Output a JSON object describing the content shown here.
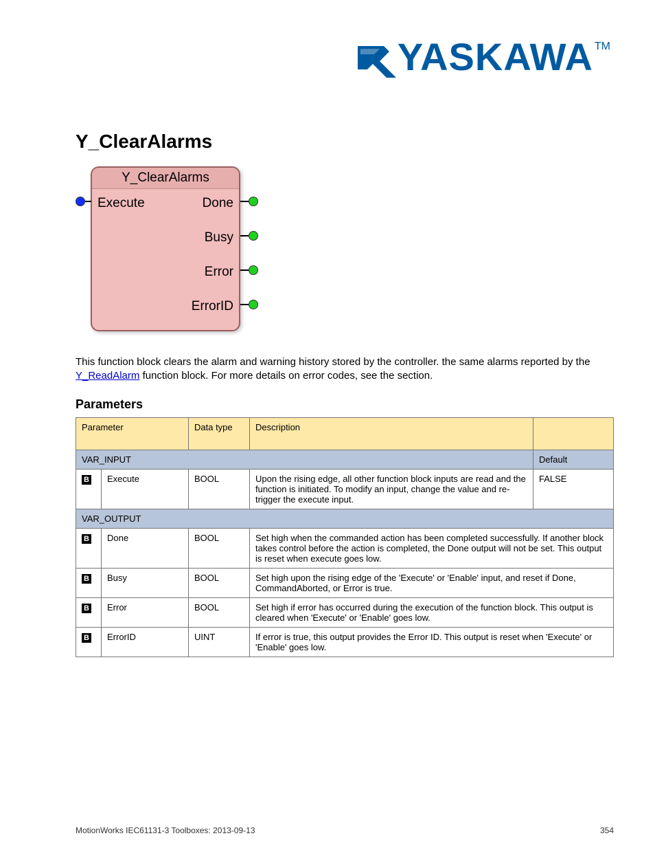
{
  "logo": {
    "text": "YASKAWA",
    "tm": "TM"
  },
  "heading": "Y_ClearAlarms",
  "fb": {
    "title": "Y_ClearAlarms",
    "input": "Execute",
    "outputs": [
      "Done",
      "Busy",
      "Error",
      "ErrorID"
    ]
  },
  "description": {
    "text_before_link": "This function block clears the alarm and warning history stored by the controller. the same alarms reported by the ",
    "link_text": "Y_ReadAlarm",
    "text_after_link": " function block. For more details on error codes, see the ",
    "text_after_desc": " section."
  },
  "params_label": "Parameters",
  "table": {
    "headers": {
      "parameter": "Parameter",
      "datatype": "Data type",
      "description": "Description",
      "default": "Default"
    },
    "group_var_input": "VAR_INPUT",
    "group_var_output": "VAR_OUTPUT",
    "rows_in": [
      {
        "marker": "B",
        "name": "Execute",
        "type": "BOOL",
        "desc": "Upon the rising edge, all other function block inputs are read and the function is initiated. To modify an input, change the value and re-trigger the execute input.",
        "default": "FALSE"
      }
    ],
    "rows_out": [
      {
        "marker": "B",
        "name": "Done",
        "type": "BOOL",
        "desc": "Set high when the commanded action has been completed successfully. If another block takes control before the action is completed, the Done output will not be set. This output is reset when execute goes low."
      },
      {
        "marker": "B",
        "name": "Busy",
        "type": "BOOL",
        "desc": "Set high upon the rising edge of the 'Execute' or 'Enable' input, and reset if Done, CommandAborted, or Error is true."
      },
      {
        "marker": "B",
        "name": "Error",
        "type": "BOOL",
        "desc": "Set high if error has occurred during the execution of the function block. This output is cleared when 'Execute' or 'Enable' goes low."
      },
      {
        "marker": "B",
        "name": "ErrorID",
        "type": "UINT",
        "desc": "If error is true, this output provides the Error ID. This output is reset when 'Execute' or 'Enable' goes low."
      }
    ]
  },
  "footer": {
    "left": "MotionWorks IEC61131-3 Toolboxes: 2013-09-13",
    "right": "354"
  }
}
